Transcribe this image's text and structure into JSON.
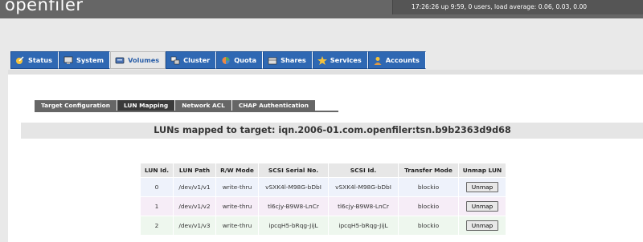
{
  "app": {
    "logo": "openfiler"
  },
  "status": {
    "uptime": "17:26:26 up 9:59, 0 users, load average: 0.06, 0.03, 0.00"
  },
  "main_tabs": [
    {
      "label": "Status",
      "icon": "status-icon"
    },
    {
      "label": "System",
      "icon": "system-icon"
    },
    {
      "label": "Volumes",
      "icon": "volumes-icon",
      "active": true
    },
    {
      "label": "Cluster",
      "icon": "cluster-icon"
    },
    {
      "label": "Quota",
      "icon": "quota-icon"
    },
    {
      "label": "Shares",
      "icon": "shares-icon"
    },
    {
      "label": "Services",
      "icon": "services-icon"
    },
    {
      "label": "Accounts",
      "icon": "accounts-icon"
    }
  ],
  "sub_tabs": [
    {
      "label": "Target Configuration"
    },
    {
      "label": "LUN Mapping",
      "active": true
    },
    {
      "label": "Network ACL"
    },
    {
      "label": "CHAP Authentication"
    }
  ],
  "page": {
    "title": "LUNs mapped to target: iqn.2006-01.com.openfiler:tsn.b9b2363d9d68"
  },
  "table": {
    "headers": [
      "LUN Id.",
      "LUN Path",
      "R/W Mode",
      "SCSI Serial No.",
      "SCSI Id.",
      "Transfer Mode",
      "Unmap LUN"
    ],
    "rows": [
      {
        "id": "0",
        "path": "/dev/v1/v1",
        "mode": "write-thru",
        "serial": "vSXK4l-M98G-bDbI",
        "scsi_id": "vSXK4l-M98G-bDbI",
        "transfer": "blockio",
        "action": "Unmap"
      },
      {
        "id": "1",
        "path": "/dev/v1/v2",
        "mode": "write-thru",
        "serial": "tl6cjy-B9W8-LnCr",
        "scsi_id": "tl6cjy-B9W8-LnCr",
        "transfer": "blockio",
        "action": "Unmap"
      },
      {
        "id": "2",
        "path": "/dev/v1/v3",
        "mode": "write-thru",
        "serial": "ipcqH5-bRqg-JijL",
        "scsi_id": "ipcqH5-bRqg-JijL",
        "transfer": "blockio",
        "action": "Unmap"
      }
    ]
  },
  "colors": {
    "tab_blue": "#2f68b3",
    "header_gray": "#666666"
  }
}
